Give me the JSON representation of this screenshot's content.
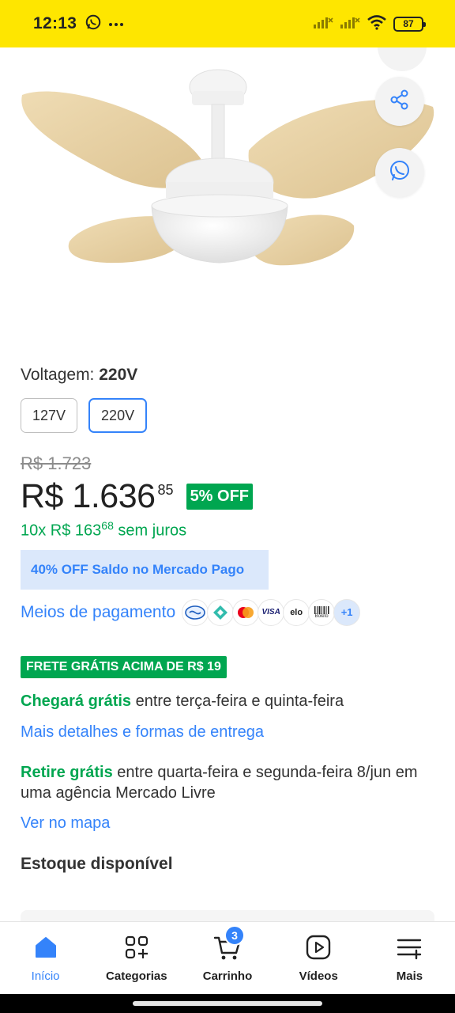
{
  "status_bar": {
    "time": "12:13",
    "battery": "87"
  },
  "variant": {
    "label": "Voltagem:",
    "selected_value": "220V",
    "options": [
      "127V",
      "220V"
    ]
  },
  "pricing": {
    "old_price": "R$ 1.723",
    "price": "R$ 1.636",
    "cents": "85",
    "discount_badge": "5% OFF",
    "installments_prefix": "10x R$ 163",
    "installments_cents": "68",
    "installments_suffix": " sem juros"
  },
  "promo_banner": "40% OFF Saldo no Mercado Pago",
  "payment": {
    "link": "Meios de pagamento",
    "methods": [
      "mercado-pago-icon",
      "pix-icon",
      "mastercard-icon",
      "visa-icon",
      "elo-icon",
      "boleto-icon"
    ],
    "visa_text": "VISA",
    "elo_text": "elo",
    "boleto_text": "Boleto",
    "more": "+1"
  },
  "shipping": {
    "free_badge": "FRETE GRÁTIS ACIMA DE R$ 19",
    "arrival_strong": "Chegará grátis",
    "arrival_rest": " entre terça-feira e quinta-feira",
    "details_link": "Mais detalhes e formas de entrega",
    "pickup_strong": "Retire grátis",
    "pickup_rest": " entre quarta-feira e segunda-feira 8/jun em uma agência Mercado Livre",
    "map_link": "Ver no mapa"
  },
  "stock_title": "Estoque disponível",
  "bottom_nav": {
    "items": [
      {
        "label": "Início",
        "icon": "home-icon",
        "active": true
      },
      {
        "label": "Categorias",
        "icon": "categories-icon"
      },
      {
        "label": "Carrinho",
        "icon": "cart-icon",
        "badge": "3"
      },
      {
        "label": "Vídeos",
        "icon": "play-video-icon"
      },
      {
        "label": "Mais",
        "icon": "more-menu-icon"
      }
    ]
  },
  "colors": {
    "brand_yellow": "#fee600",
    "link_blue": "#3483fa",
    "success_green": "#00a650"
  }
}
